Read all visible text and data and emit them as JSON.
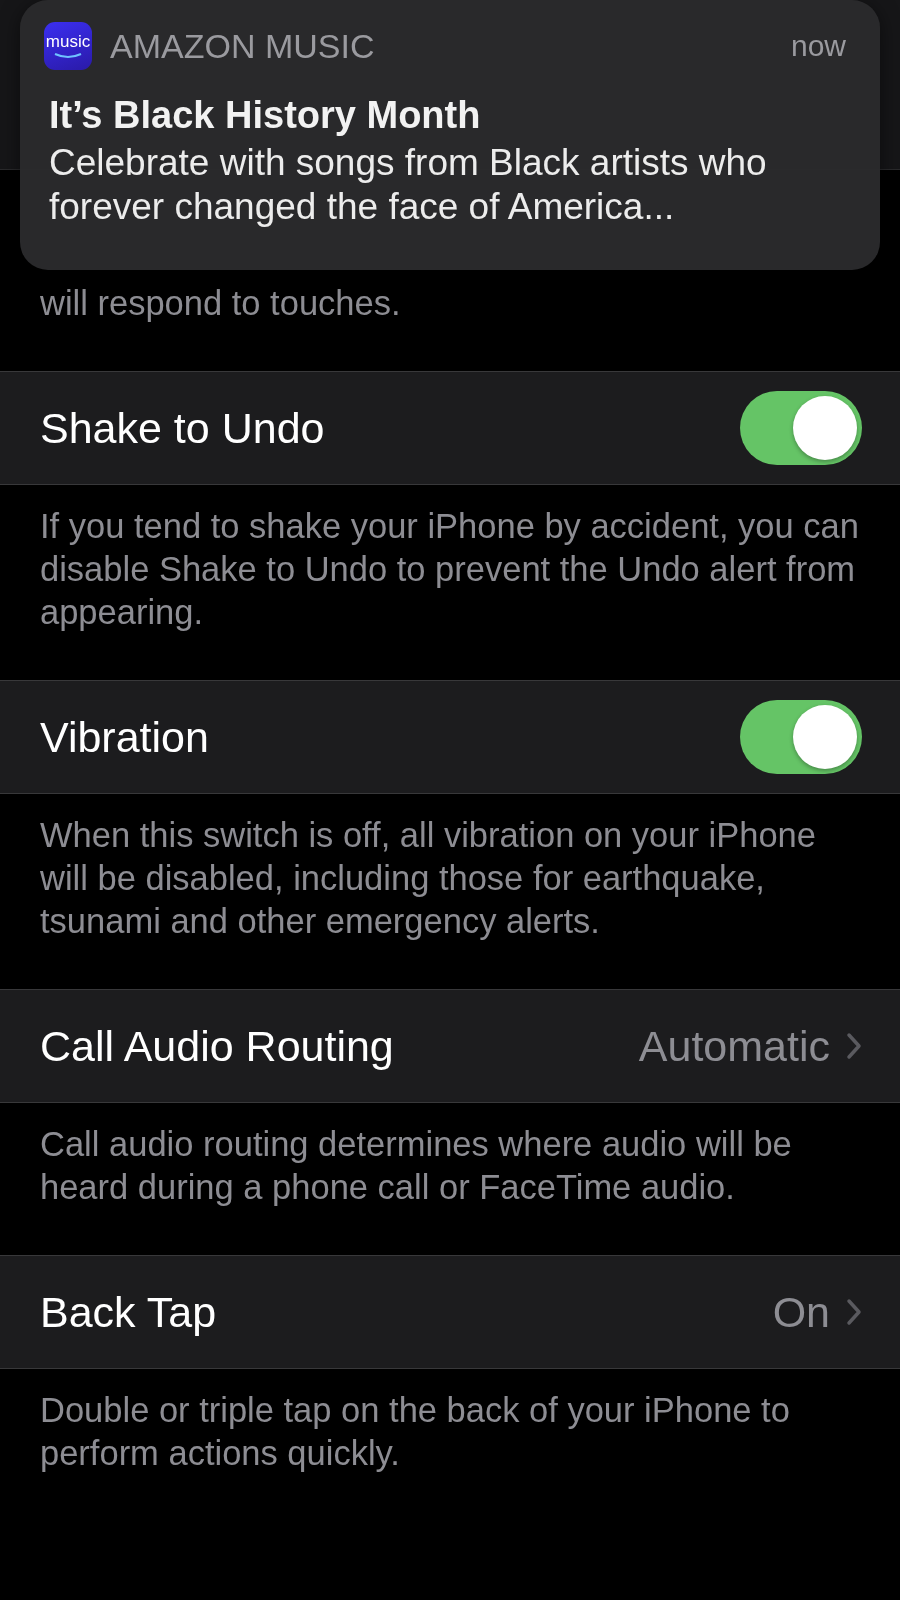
{
  "notification": {
    "app": "AMAZON MUSIC",
    "app_icon_text": "music",
    "time": "now",
    "title": "It’s Black History Month",
    "body": "Celebrate with songs from Black artists who forever changed the face of America..."
  },
  "top_footer": "will respond to touches.",
  "settings": [
    {
      "kind": "toggle",
      "label": "Shake to Undo",
      "on": true,
      "footer": "If you tend to shake your iPhone by accident, you can disable Shake to Undo to prevent the Undo alert from appearing."
    },
    {
      "kind": "toggle",
      "label": "Vibration",
      "on": true,
      "footer": "When this switch is off, all vibration on your iPhone will be disabled, including those for earthquake, tsunami and other emergency alerts."
    },
    {
      "kind": "link",
      "label": "Call Audio Routing",
      "value": "Automatic",
      "footer": "Call audio routing determines where audio will be heard during a phone call or FaceTime audio."
    },
    {
      "kind": "link",
      "label": "Back Tap",
      "value": "On",
      "footer": "Double or triple tap on the back of your iPhone to perform actions quickly."
    }
  ]
}
